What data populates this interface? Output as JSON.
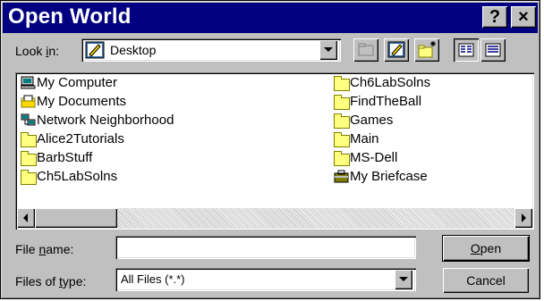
{
  "dialog": {
    "title": "Open World",
    "help_btn": "?",
    "close_btn": "×"
  },
  "lookin": {
    "label_pre": "Look ",
    "label_u": "i",
    "label_post": "n:",
    "value": "Desktop"
  },
  "toolbar": {
    "icons": [
      "up-one-level-icon",
      "desktop-icon",
      "new-folder-icon",
      "list-view-icon",
      "details-view-icon"
    ]
  },
  "files": {
    "left": [
      {
        "name": "My Computer",
        "icon": "my-computer-icon"
      },
      {
        "name": "My Documents",
        "icon": "my-documents-icon"
      },
      {
        "name": "Network Neighborhood",
        "icon": "network-icon"
      },
      {
        "name": "Alice2Tutorials",
        "icon": "folder-icon"
      },
      {
        "name": "BarbStuff",
        "icon": "folder-icon"
      },
      {
        "name": "Ch5LabSolns",
        "icon": "folder-icon"
      }
    ],
    "right": [
      {
        "name": "Ch6LabSolns",
        "icon": "folder-icon"
      },
      {
        "name": "FindTheBall",
        "icon": "folder-icon"
      },
      {
        "name": "Games",
        "icon": "folder-icon"
      },
      {
        "name": "Main",
        "icon": "folder-icon"
      },
      {
        "name": "MS-Dell",
        "icon": "folder-icon"
      },
      {
        "name": "My Briefcase",
        "icon": "briefcase-icon"
      }
    ]
  },
  "filename": {
    "label_pre": "File ",
    "label_u": "n",
    "label_post": "ame:",
    "value": ""
  },
  "filetype": {
    "label_pre": "Files of ",
    "label_u": "t",
    "label_post": "ype:",
    "value": "All Files (*.*)"
  },
  "buttons": {
    "open_u": "O",
    "open_rest": "pen",
    "cancel": "Cancel"
  }
}
